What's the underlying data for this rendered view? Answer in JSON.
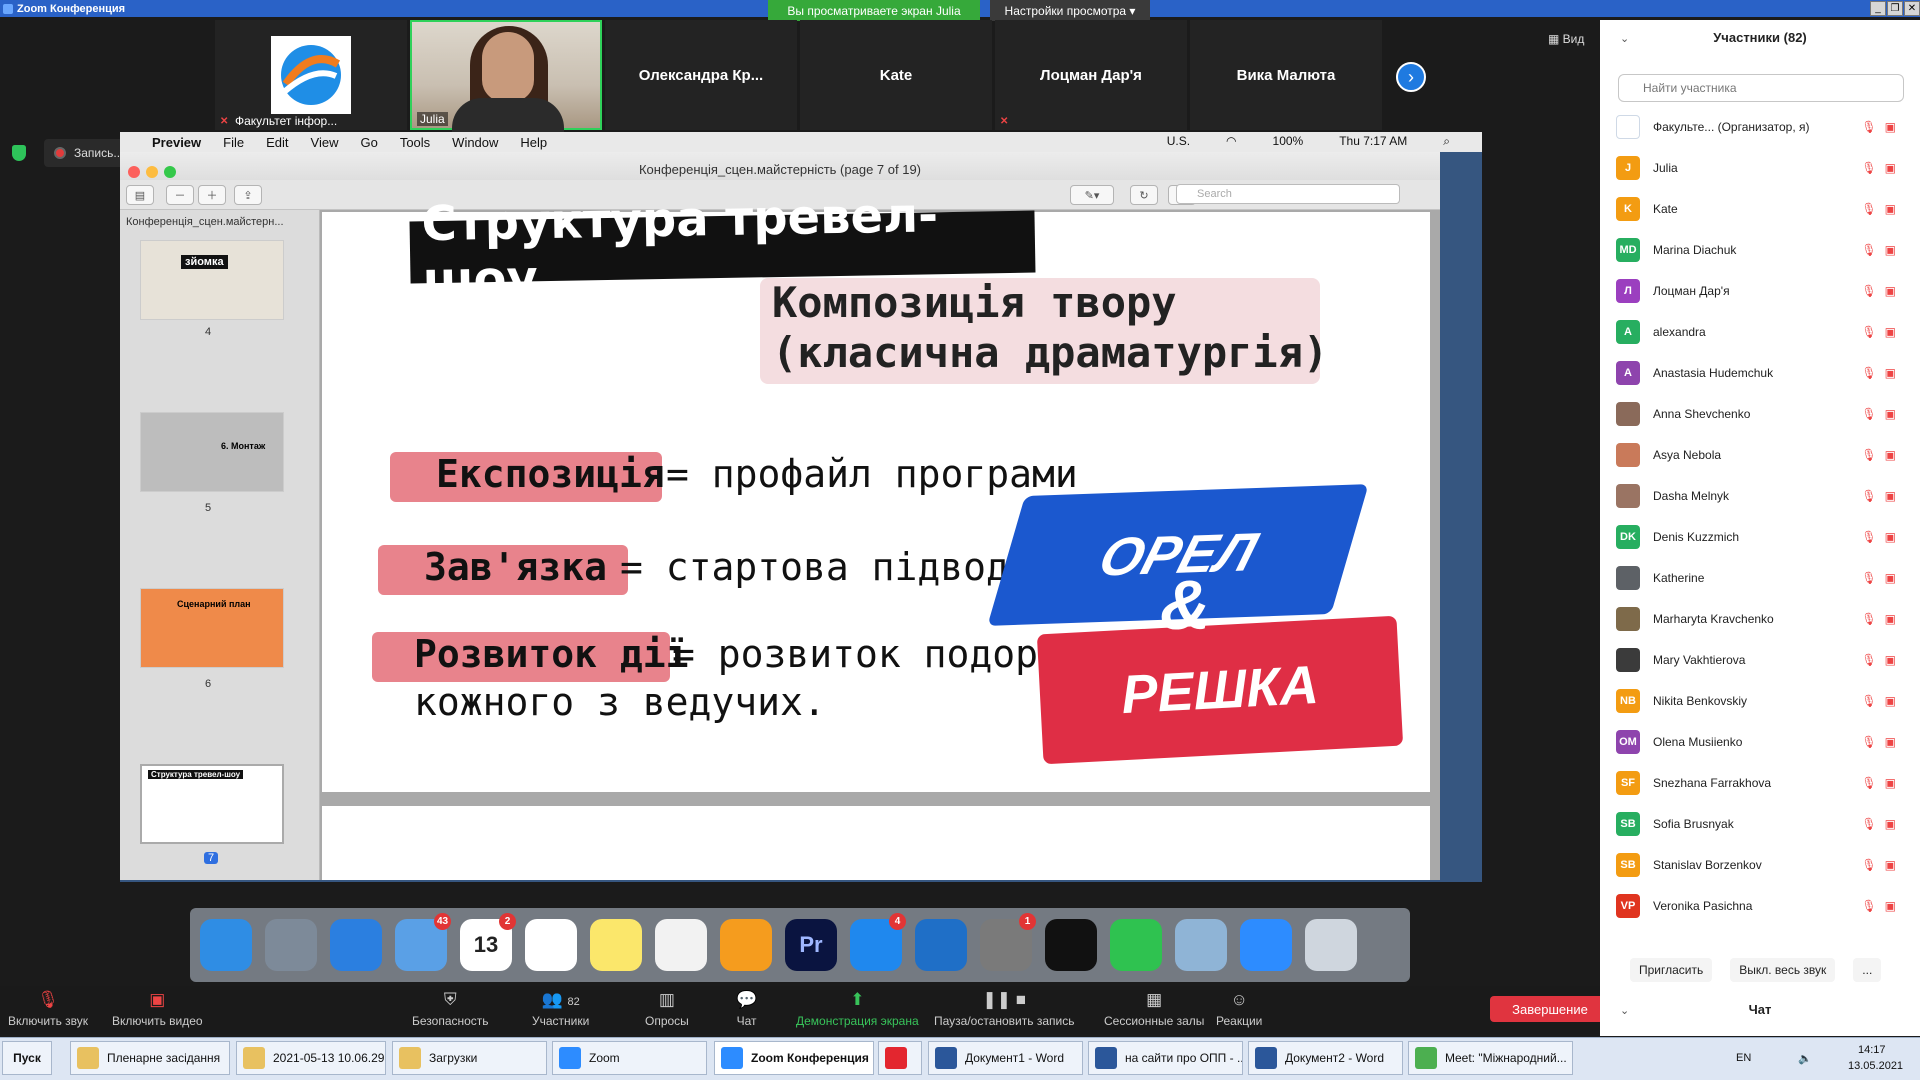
{
  "window": {
    "title": "Zoom Конференция",
    "share_notice": "Вы просматриваете экран Julia",
    "view_settings": "Настройки просмотра",
    "view_button": "Вид"
  },
  "video_strip": {
    "tiles": [
      {
        "name": "Факультет інфор..."
      },
      {
        "name": "Julia"
      },
      {
        "name": "Олександра  Кр..."
      },
      {
        "name": "Kate"
      },
      {
        "name": "Лоцман Дар'я"
      },
      {
        "name": "Вика Малюта"
      }
    ]
  },
  "recording": {
    "label": "Запись..."
  },
  "mac": {
    "menu": [
      "Preview",
      "File",
      "Edit",
      "View",
      "Go",
      "Tools",
      "Window",
      "Help"
    ],
    "status": {
      "locale": "U.S.",
      "battery": "100%",
      "clock": "Thu 7:17 AM"
    },
    "preview_title": "Конференція_сцен.майстерність  (page 7 of 19)",
    "search_placeholder": "Search",
    "sidebar_title": "Конференція_сцен.майстерн...",
    "thumbs": [
      {
        "num": "4",
        "text": "зйомка"
      },
      {
        "num": "5",
        "text": "6. Монтаж"
      },
      {
        "num": "6",
        "text": "Сценарний план"
      },
      {
        "num": "7",
        "text": "Структура тревел-шоу"
      }
    ],
    "slide": {
      "title": "Структура тревел-шоу",
      "subtitle1": "Композиція твору",
      "subtitle2": "(класична драматургія)",
      "rows": [
        {
          "term": "Експозиція",
          "def": "= профайл програми"
        },
        {
          "term": "Зав'язка",
          "def": "= стартова підводка"
        },
        {
          "term": "Розвиток дії",
          "def": "= розвиток подорожі"
        }
      ],
      "row3_line2": "кожного з ведучих.",
      "logo_top": "ОРЕЛ",
      "logo_amp": "&",
      "logo_bottom": "РЕШКА"
    },
    "dock": [
      {
        "name": "finder",
        "color": "#2f8de4"
      },
      {
        "name": "launchpad",
        "color": "#7d8a99"
      },
      {
        "name": "safari",
        "color": "#2b7fe0"
      },
      {
        "name": "mail",
        "color": "#5aa0e6",
        "badge": "43"
      },
      {
        "name": "calendar",
        "color": "#ffffff",
        "badge": "2",
        "label": "13"
      },
      {
        "name": "reminders",
        "color": "#ffffff"
      },
      {
        "name": "notes",
        "color": "#fbe76b"
      },
      {
        "name": "music",
        "color": "#f2f2f2"
      },
      {
        "name": "pages",
        "color": "#f59c1e"
      },
      {
        "name": "premiere",
        "color": "#0a1440",
        "label": "Pr"
      },
      {
        "name": "appstore",
        "color": "#1f88ee",
        "badge": "4"
      },
      {
        "name": "trello",
        "color": "#1f6fc7"
      },
      {
        "name": "settings",
        "color": "#7a7a7a",
        "badge": "1"
      },
      {
        "name": "terminal",
        "color": "#111111"
      },
      {
        "name": "whatsapp",
        "color": "#2fc250"
      },
      {
        "name": "preview",
        "color": "#8fb4d6"
      },
      {
        "name": "zoom",
        "color": "#2d8cff"
      },
      {
        "name": "trash",
        "color": "#cfd6de"
      }
    ]
  },
  "toolbar": {
    "unmute": "Включить звук",
    "start_video": "Включить видео",
    "security": "Безопасность",
    "participants": "Участники",
    "participants_count": "82",
    "polls": "Опросы",
    "chat": "Чат",
    "share": "Демонстрация экрана",
    "pause_rec": "Пауза/остановить запись",
    "breakout": "Сессионные залы",
    "reactions": "Реакции",
    "end": "Завершение"
  },
  "participants": {
    "title": "Участники (82)",
    "search_placeholder": "Найти участника",
    "list": [
      {
        "initials": "",
        "name": "Факульте...  (Организатор, я)",
        "color": "#ffffff"
      },
      {
        "initials": "J",
        "name": "Julia",
        "color": "#f39c12"
      },
      {
        "initials": "K",
        "name": "Kate",
        "color": "#f39c12"
      },
      {
        "initials": "MD",
        "name": "Marina Diachuk",
        "color": "#27ae60"
      },
      {
        "initials": "Л",
        "name": "Лоцман Дар'я",
        "color": "#9b3fbf"
      },
      {
        "initials": "A",
        "name": "alexandra",
        "color": "#27ae60"
      },
      {
        "initials": "A",
        "name": "Anastasia Hudemchuk",
        "color": "#8e44ad"
      },
      {
        "initials": "",
        "name": "Anna Shevchenko",
        "color": "#8a6a5a"
      },
      {
        "initials": "",
        "name": "Asya Nebola",
        "color": "#c97a5a"
      },
      {
        "initials": "",
        "name": "Dasha Melnyk",
        "color": "#9a7463"
      },
      {
        "initials": "DK",
        "name": "Denis Kuzzmich",
        "color": "#27ae60"
      },
      {
        "initials": "",
        "name": "Katherine",
        "color": "#5d6166"
      },
      {
        "initials": "",
        "name": "Marharyta Kravchenko",
        "color": "#7e6a4a"
      },
      {
        "initials": "",
        "name": "Mary Vakhtierova",
        "color": "#3b3b3b"
      },
      {
        "initials": "NB",
        "name": "Nikita Benkovskiy",
        "color": "#f39c12"
      },
      {
        "initials": "OM",
        "name": "Olena Musiienko",
        "color": "#8e44ad"
      },
      {
        "initials": "SF",
        "name": "Snezhana Farrakhova",
        "color": "#f39c12"
      },
      {
        "initials": "SB",
        "name": "Sofia Brusnyak",
        "color": "#27ae60"
      },
      {
        "initials": "SB",
        "name": "Stanislav Borzenkov",
        "color": "#f39c12"
      },
      {
        "initials": "VP",
        "name": "Veronika Pasichna",
        "color": "#e0341f"
      }
    ],
    "invite": "Пригласить",
    "mute_all": "Выкл. весь звук",
    "more": "...",
    "chat": "Чат"
  },
  "taskbar": {
    "start": "Пуск",
    "items": [
      {
        "label": "Пленарне засідання",
        "color": "#e8c160"
      },
      {
        "label": "2021-05-13 10.06.29...",
        "color": "#e8c160"
      },
      {
        "label": "Загрузки",
        "color": "#e8c160"
      },
      {
        "label": "Zoom",
        "color": "#2d8cff"
      },
      {
        "label": "Zoom Конференция",
        "color": "#2d8cff"
      },
      {
        "label": "",
        "color": "#e3262f"
      },
      {
        "label": "Документ1 - Word",
        "color": "#2b579a"
      },
      {
        "label": "на сайти про ОПП - ...",
        "color": "#2b579a"
      },
      {
        "label": "Документ2 - Word",
        "color": "#2b579a"
      },
      {
        "label": "Meet: \"Міжнародний...",
        "color": "#4caf50"
      }
    ],
    "lang": "EN",
    "time": "14:17",
    "date": "13.05.2021"
  }
}
